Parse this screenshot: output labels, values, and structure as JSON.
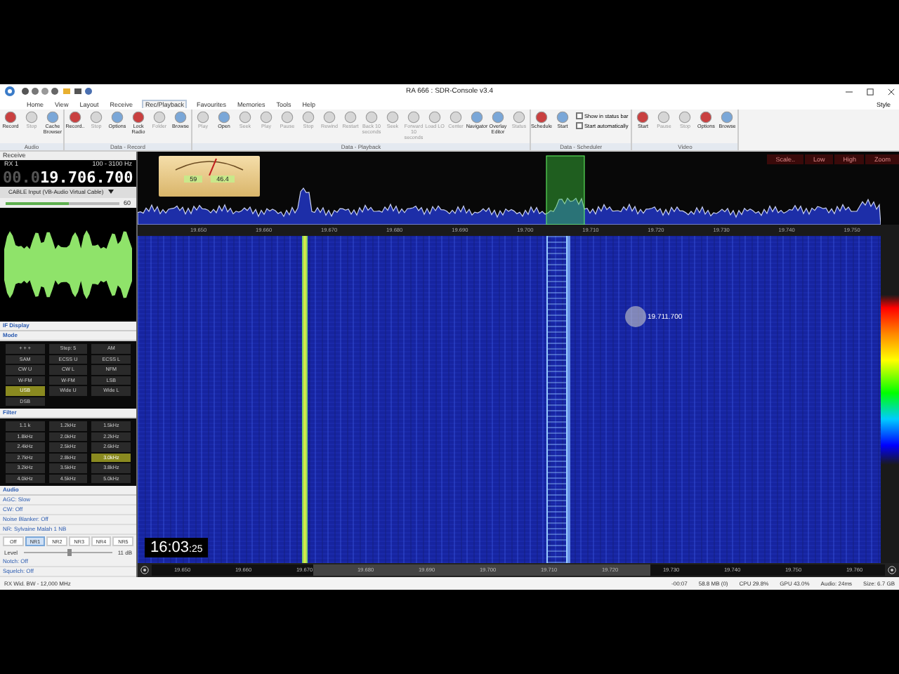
{
  "window": {
    "title": "RA 666 : SDR-Console v3.4",
    "style_label": "Style"
  },
  "menu_tabs": [
    {
      "label": "Home",
      "selected": false
    },
    {
      "label": "View",
      "selected": false
    },
    {
      "label": "Layout",
      "selected": false
    },
    {
      "label": "Receive",
      "selected": false
    },
    {
      "label": "Rec/Playback",
      "selected": true
    },
    {
      "label": "Favourites",
      "selected": false
    },
    {
      "label": "Memories",
      "selected": false
    },
    {
      "label": "Tools",
      "selected": false
    },
    {
      "label": "Help",
      "selected": false
    }
  ],
  "ribbon": [
    {
      "label": "Audio",
      "buttons": [
        {
          "label": "Record",
          "disabled": false
        },
        {
          "label": "Stop",
          "disabled": true
        },
        {
          "label": "Cache Browser",
          "disabled": false
        }
      ]
    },
    {
      "label": "Data - Record",
      "buttons": [
        {
          "label": "Record..",
          "disabled": false
        },
        {
          "label": "Stop",
          "disabled": true
        },
        {
          "label": "Options",
          "disabled": false
        },
        {
          "label": "Lock Radio",
          "disabled": false
        },
        {
          "label": "Folder",
          "disabled": true
        },
        {
          "label": "Browse",
          "disabled": false
        }
      ]
    },
    {
      "label": "Data - Playback",
      "buttons": [
        {
          "label": "Play",
          "disabled": true
        },
        {
          "label": "Open",
          "disabled": false
        },
        {
          "label": "Seek",
          "disabled": true
        },
        {
          "label": "Play",
          "disabled": true
        },
        {
          "label": "Pause",
          "disabled": true
        },
        {
          "label": "Stop",
          "disabled": true
        },
        {
          "label": "Rewind",
          "disabled": true
        },
        {
          "label": "Restart",
          "disabled": true
        },
        {
          "label": "Back 10 seconds",
          "disabled": true
        },
        {
          "label": "Seek",
          "disabled": true
        },
        {
          "label": "Forward 10 seconds",
          "disabled": true
        },
        {
          "label": "Load LO",
          "disabled": true
        },
        {
          "label": "Center",
          "disabled": true
        },
        {
          "label": "Navigator",
          "disabled": false
        },
        {
          "label": "Overlay Editor",
          "disabled": false
        },
        {
          "label": "Status",
          "disabled": true
        }
      ]
    },
    {
      "label": "Data - Scheduler",
      "buttons": [
        {
          "label": "Schedule",
          "disabled": false
        },
        {
          "label": "Start",
          "disabled": false
        }
      ],
      "options": [
        {
          "label": "Show in status bar",
          "checked": false
        },
        {
          "label": "Start automatically",
          "checked": false
        }
      ]
    },
    {
      "label": "Video",
      "buttons": [
        {
          "label": "Start",
          "disabled": false
        },
        {
          "label": "Pause",
          "disabled": true
        },
        {
          "label": "Stop",
          "disabled": true
        },
        {
          "label": "Options",
          "disabled": false
        },
        {
          "label": "Browse",
          "disabled": false
        }
      ]
    }
  ],
  "receive": {
    "title": "Receive",
    "rx": "RX 1",
    "bandwidth": "100 - 3100 Hz",
    "frequency_dim": "00.0",
    "frequency": "19.706.700",
    "audio_device": "CABLE Input (VB-Audio Virtual Cable)",
    "volume": {
      "level": 0.55,
      "reading": "60"
    }
  },
  "sections": {
    "if_display": "IF Display",
    "mode": "Mode",
    "filter": "Filter",
    "audio": "Audio"
  },
  "modes": [
    {
      "label": "+ + +",
      "selected": false
    },
    {
      "label": "Step: 5",
      "selected": false
    },
    {
      "label": "AM",
      "selected": false
    },
    {
      "label": "SAM",
      "selected": false
    },
    {
      "label": "ECSS U",
      "selected": false
    },
    {
      "label": "ECSS L",
      "selected": false
    },
    {
      "label": "CW U",
      "selected": false
    },
    {
      "label": "CW L",
      "selected": false
    },
    {
      "label": "NFM",
      "selected": false
    },
    {
      "label": "W-FM",
      "selected": false
    },
    {
      "label": "W-FM",
      "selected": false
    },
    {
      "label": "LSB",
      "selected": false
    },
    {
      "label": "USB",
      "selected": true
    },
    {
      "label": "Wide U",
      "selected": false
    },
    {
      "label": "Wide L",
      "selected": false
    },
    {
      "label": "DSB",
      "selected": false
    }
  ],
  "filters": [
    {
      "label": "1.1 k",
      "selected": false
    },
    {
      "label": "1.2kHz",
      "selected": false
    },
    {
      "label": "1.5kHz",
      "selected": false
    },
    {
      "label": "1.8kHz",
      "selected": false
    },
    {
      "label": "2.0kHz",
      "selected": false
    },
    {
      "label": "2.2kHz",
      "selected": false
    },
    {
      "label": "2.4kHz",
      "selected": false
    },
    {
      "label": "2.5kHz",
      "selected": false
    },
    {
      "label": "2.6kHz",
      "selected": false
    },
    {
      "label": "2.7kHz",
      "selected": false
    },
    {
      "label": "2.8kHz",
      "selected": false
    },
    {
      "label": "3.0kHz",
      "selected": true
    },
    {
      "label": "3.2kHz",
      "selected": false
    },
    {
      "label": "3.5kHz",
      "selected": false
    },
    {
      "label": "3.8kHz",
      "selected": false
    },
    {
      "label": "4.0kHz",
      "selected": false
    },
    {
      "label": "4.5kHz",
      "selected": false
    },
    {
      "label": "5.0kHz",
      "selected": false
    }
  ],
  "audio_settings": [
    "AGC: Slow",
    "CW: Off",
    "Noise Blanker: Off",
    "NR: Sylvaine Malah 1 NB"
  ],
  "nr_buttons": [
    {
      "label": "Off",
      "selected": false
    },
    {
      "label": "NR1",
      "selected": true
    },
    {
      "label": "NR2",
      "selected": false
    },
    {
      "label": "NR3",
      "selected": false
    },
    {
      "label": "NR4",
      "selected": false
    },
    {
      "label": "NR5",
      "selected": false
    }
  ],
  "nr_level": {
    "label": "Level",
    "level": 0.5,
    "reading": "11 dB"
  },
  "audio_settings_after": [
    "Notch: Off",
    "Squelch: Off"
  ],
  "meter": {
    "readings": [
      "59",
      "46.4"
    ]
  },
  "spectrum_controls": [
    "Scale..",
    "Low",
    "High",
    "Zoom"
  ],
  "top_axis": [
    "19.650",
    "19.660",
    "19.670",
    "19.680",
    "19.690",
    "19.700",
    "19.710",
    "19.720",
    "19.730",
    "19.740",
    "19.750"
  ],
  "cursor_frequency": "19.711.700",
  "clock": {
    "time": "16:03",
    "seconds": ":25"
  },
  "overview_axis": [
    "19.650",
    "19.660",
    "19.670",
    "19.680",
    "19.690",
    "19.700",
    "19.710",
    "19.720",
    "19.730",
    "19.740",
    "19.750",
    "19.760"
  ],
  "status_bar": {
    "left": "RX Wid. BW - 12,000 MHz",
    "items": [
      "-00:07",
      "58.8 MB (0)",
      "CPU 29.8%",
      "GPU 43.0%",
      "Audio: 24ms",
      "Size: 6.7 GB"
    ]
  }
}
